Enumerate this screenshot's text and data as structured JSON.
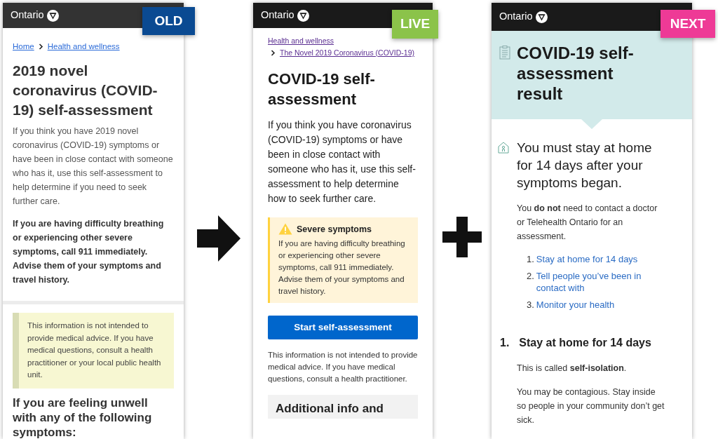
{
  "panels": [
    {
      "badge": {
        "label": "OLD",
        "color": "#0a4a92"
      },
      "header": {
        "brand": "Ontario"
      },
      "blocks": [
        {
          "kind": "breadcrumb",
          "links": [
            "Home",
            "Health and wellness"
          ]
        },
        {
          "kind": "heading",
          "text": "2019 novel coronavirus (COVID-19) self-assessment"
        },
        {
          "kind": "paragraph",
          "text": "If you think you have 2019 novel coronavirus (COVID-19) symptoms or have been in close contact with someone who has it, use this self-assessment to help determine if you need to seek further care."
        },
        {
          "kind": "strong_paragraph",
          "text": "If you are having difficulty breathing or experiencing other severe symptoms, call 911 immediately. Advise them of your symptoms and travel history."
        },
        {
          "kind": "divider"
        },
        {
          "kind": "note",
          "text": "This information is not intended to provide medical advice. If you have medical questions, consult a health practitioner or your local public health unit."
        },
        {
          "kind": "subheading",
          "text": "If you are feeling unwell with any of the following symptoms:"
        }
      ]
    },
    {
      "badge": {
        "label": "LIVE",
        "color": "#8bc34a"
      },
      "header": {
        "brand": "Ontario"
      },
      "blocks": [
        {
          "kind": "stacked_breadcrumb",
          "links": [
            "Health and wellness",
            "The Novel 2019 Coronavirus (COVID-19)"
          ]
        },
        {
          "kind": "heading",
          "text": "COVID-19 self-assessment"
        },
        {
          "kind": "paragraph",
          "text": "If you think you have coronavirus (COVID-19) symptoms or have been in close contact with someone who has it, use this self-assessment to help determine how to seek further care."
        },
        {
          "kind": "alert",
          "title": "Severe symptoms",
          "text": "If you are having difficulty breathing or experiencing other severe symptoms, call 911 immediately. Advise them of your symptoms and travel history."
        },
        {
          "kind": "button",
          "label": "Start self-assessment"
        },
        {
          "kind": "small_paragraph",
          "text": "This information is not intended to provide medical advice. If you have medical questions, consult a health practitioner."
        },
        {
          "kind": "section_box",
          "text": "Additional info and"
        }
      ]
    },
    {
      "badge": {
        "label": "NEXT",
        "color": "#ee3a96"
      },
      "header": {
        "brand": "Ontario"
      },
      "blocks": [
        {
          "kind": "result_banner",
          "text": "COVID-19 self-assessment result"
        },
        {
          "kind": "lead",
          "text": "You must stay at home for 14 days after your symptoms began."
        },
        {
          "kind": "small_paragraph",
          "text": "You **do not** need to contact a doctor or Telehealth Ontario for an assessment."
        },
        {
          "kind": "numbered_links",
          "items": [
            {
              "number": "1.",
              "label": "Stay at home for 14 days"
            },
            {
              "number": "2.",
              "label": "Tell people you’ve been in contact with"
            },
            {
              "number": "3.",
              "label": "Monitor your health"
            }
          ]
        },
        {
          "kind": "step_heading",
          "number": "1.",
          "text": "Stay at home for 14 days"
        },
        {
          "kind": "small_paragraph",
          "text": "This is called **self-isolation**."
        },
        {
          "kind": "small_paragraph",
          "text": "You may be contagious. Stay inside so people in your community don’t get sick."
        }
      ]
    }
  ]
}
